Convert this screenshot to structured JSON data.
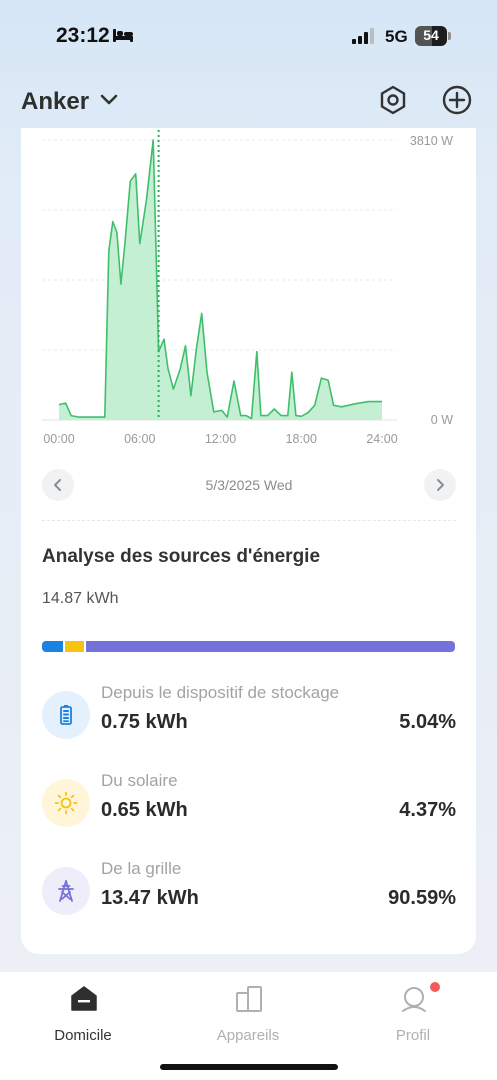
{
  "status_bar": {
    "time": "23:12",
    "network": "5G",
    "battery": "54",
    "battery_fraction": 0.54
  },
  "header": {
    "brand": "Anker"
  },
  "chart_data": {
    "type": "area",
    "y_max_label": "3810 W",
    "y_min_label": "0 W",
    "ylim": [
      0,
      3810
    ],
    "xlim": [
      0,
      24
    ],
    "x_ticks": [
      "00:00",
      "06:00",
      "12:00",
      "18:00",
      "24:00"
    ],
    "x_tick_values": [
      0,
      6,
      12,
      18,
      24
    ],
    "marker_x": 7.4,
    "grid": true,
    "color": "#3fbf6b",
    "fill": "#c5efd3",
    "x": [
      0,
      0.5,
      0.9,
      1.5,
      2.5,
      3.4,
      3.7,
      4.0,
      4.3,
      4.6,
      4.9,
      5.3,
      5.7,
      6.0,
      6.5,
      7.0,
      7.4,
      7.8,
      8.1,
      8.5,
      9.0,
      9.4,
      9.8,
      10.2,
      10.6,
      11.0,
      11.5,
      12.1,
      12.5,
      13.0,
      13.5,
      13.9,
      14.3,
      14.7,
      15.0,
      15.5,
      16.0,
      16.5,
      17.0,
      17.3,
      17.6,
      18.0,
      18.5,
      19.0,
      19.5,
      20.0,
      20.4,
      21.0,
      22.0,
      23.0,
      24.0
    ],
    "values": [
      210,
      230,
      60,
      40,
      40,
      40,
      2300,
      2700,
      2550,
      1850,
      2400,
      3250,
      3350,
      2400,
      3000,
      3810,
      930,
      1100,
      700,
      420,
      690,
      1010,
      330,
      960,
      1450,
      650,
      110,
      130,
      40,
      530,
      60,
      60,
      20,
      930,
      60,
      60,
      150,
      60,
      60,
      650,
      60,
      50,
      100,
      200,
      570,
      540,
      200,
      180,
      220,
      250,
      250
    ]
  },
  "date_nav": {
    "date": "5/3/2025 Wed"
  },
  "analysis": {
    "title": "Analyse des sources d'énergie",
    "total": "14.87 kWh",
    "bar": [
      {
        "name": "Depuis le dispositif de stockage",
        "fraction": 0.0504,
        "color": "#1a82e2"
      },
      {
        "name": "Du solaire",
        "fraction": 0.0437,
        "color": "#f6c311"
      },
      {
        "name": "De la grille",
        "fraction": 0.9059,
        "color": "#7472da"
      }
    ],
    "sources": [
      {
        "label": "Depuis le dispositif de stockage",
        "value": "0.75 kWh",
        "percent": "5.04%",
        "icon": "battery-icon",
        "bg": "#e4f1fc",
        "color": "#1a82e2"
      },
      {
        "label": "Du solaire",
        "value": "0.65 kWh",
        "percent": "4.37%",
        "icon": "sun-icon",
        "bg": "#fff6da",
        "color": "#f6c311"
      },
      {
        "label": "De la grille",
        "value": "13.47 kWh",
        "percent": "90.59%",
        "icon": "power-tower-icon",
        "bg": "#eeeefb",
        "color": "#7472da"
      }
    ]
  },
  "bottom_nav": {
    "items": [
      {
        "label": "Domicile",
        "icon": "home-icon",
        "active": true
      },
      {
        "label": "Appareils",
        "icon": "devices-icon",
        "active": false
      },
      {
        "label": "Profil",
        "icon": "profile-icon",
        "active": false
      }
    ]
  }
}
